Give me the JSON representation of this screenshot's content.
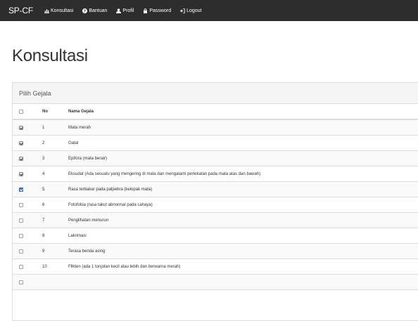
{
  "navbar": {
    "brand": "SP-CF",
    "items": [
      {
        "label": "Konsultasi",
        "icon": "bar-chart-icon"
      },
      {
        "label": "Bantuan",
        "icon": "help-circle-icon"
      },
      {
        "label": "Profil",
        "icon": "user-icon"
      },
      {
        "label": "Password",
        "icon": "lock-icon"
      },
      {
        "label": "Logout",
        "icon": "logout-icon"
      }
    ]
  },
  "page": {
    "title": "Konsultasi"
  },
  "panel": {
    "heading": "Pilih Gejala",
    "columns": {
      "no": "No",
      "name": "Nama Gejala"
    },
    "rows": [
      {
        "no": "1",
        "name": "Mata merah",
        "checked": true
      },
      {
        "no": "2",
        "name": "Gatal",
        "checked": true
      },
      {
        "no": "3",
        "name": "Epifora (mata berair)",
        "checked": true
      },
      {
        "no": "4",
        "name": "Eksudat (Ada sesuatu yang mengering di mata dan mengalami perlekatan pada mata atas dan bawah)",
        "checked": true
      },
      {
        "no": "5",
        "name": "Rasa terbakar pada palpebra (kelopak mata)",
        "checked": true,
        "focused": true
      },
      {
        "no": "6",
        "name": "Fotofobia (rasa takut abnormal pada cahaya)",
        "checked": false
      },
      {
        "no": "7",
        "name": "Penglihatan menurun",
        "checked": false
      },
      {
        "no": "8",
        "name": "Lakrimasi",
        "checked": false
      },
      {
        "no": "9",
        "name": "Terasa benda asing",
        "checked": false
      },
      {
        "no": "10",
        "name": "Fllkten (ada 1 tonjolan kecil atau lebih dan berwarna merah)",
        "checked": false
      },
      {
        "no": "",
        "name": "",
        "checked": false
      }
    ]
  },
  "colors": {
    "navbar_bg": "#2d2d2d",
    "checkbox_focus": "#3b7dd8"
  }
}
